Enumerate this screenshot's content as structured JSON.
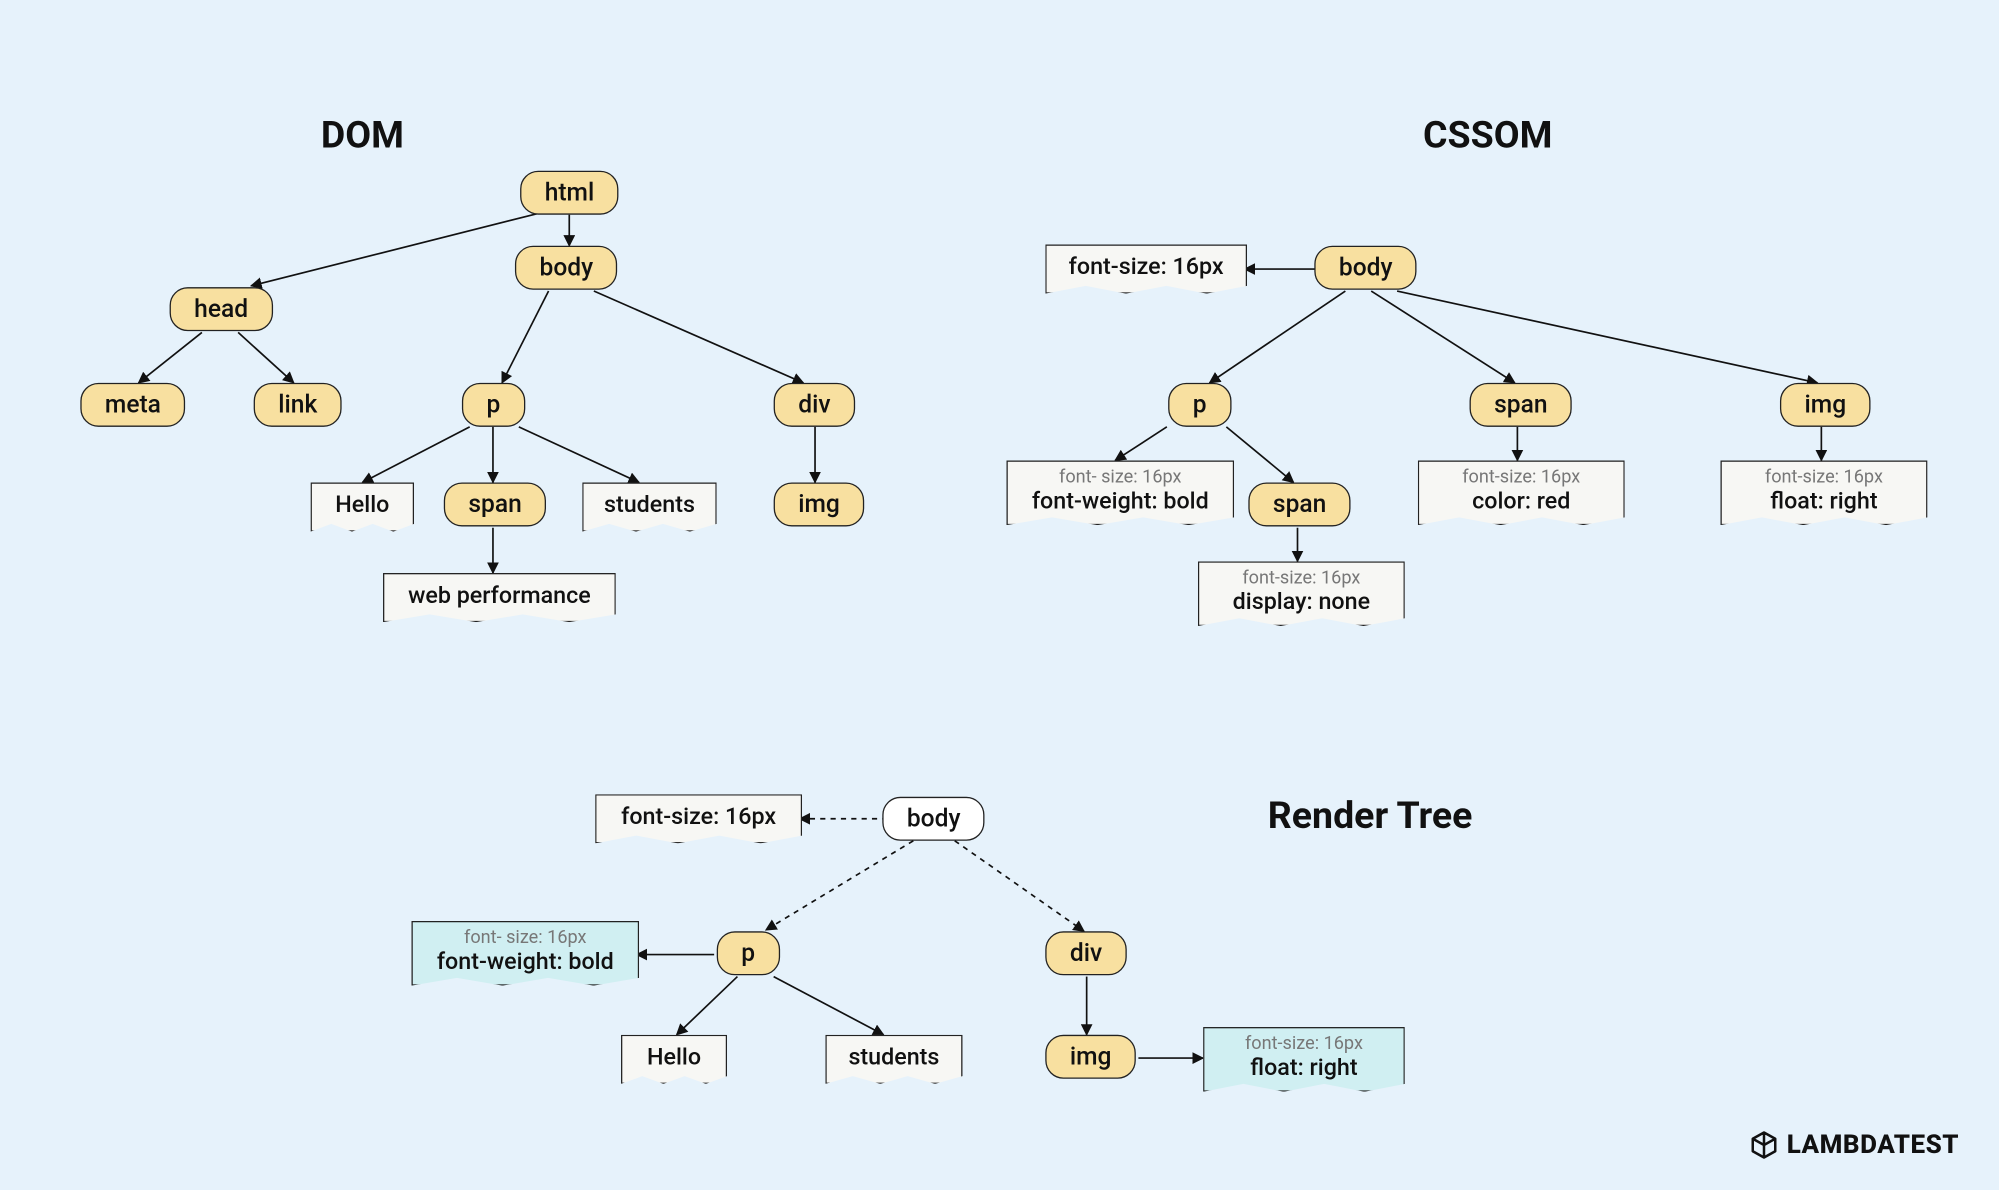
{
  "titles": {
    "dom": "DOM",
    "cssom": "CSSOM",
    "render": "Render Tree"
  },
  "dom": {
    "html": "html",
    "head": "head",
    "body": "body",
    "meta": "meta",
    "link": "link",
    "p": "p",
    "div": "div",
    "hello": "Hello",
    "span": "span",
    "students": "students",
    "img": "img",
    "webperf": "web performance"
  },
  "cssom": {
    "body": "body",
    "body_note": "font-size: 16px",
    "p": "p",
    "p_note1": "font- size: 16px",
    "p_note2": "font-weight: bold",
    "span": "span",
    "span_note1": "font-size: 16px",
    "span_note2": "color: red",
    "img": "img",
    "img_note1": "font-size: 16px",
    "img_note2": "float: right",
    "span2": "span",
    "span2_note1": "font-size: 16px",
    "span2_note2": "display: none"
  },
  "render": {
    "body": "body",
    "body_note": "font-size: 16px",
    "p": "p",
    "p_note1": "font- size: 16px",
    "p_note2": "font-weight: bold",
    "hello": "Hello",
    "students": "students",
    "div": "div",
    "img": "img",
    "img_note1": "font-size: 16px",
    "img_note2": "float: right"
  },
  "brand": "LAMBDATEST"
}
